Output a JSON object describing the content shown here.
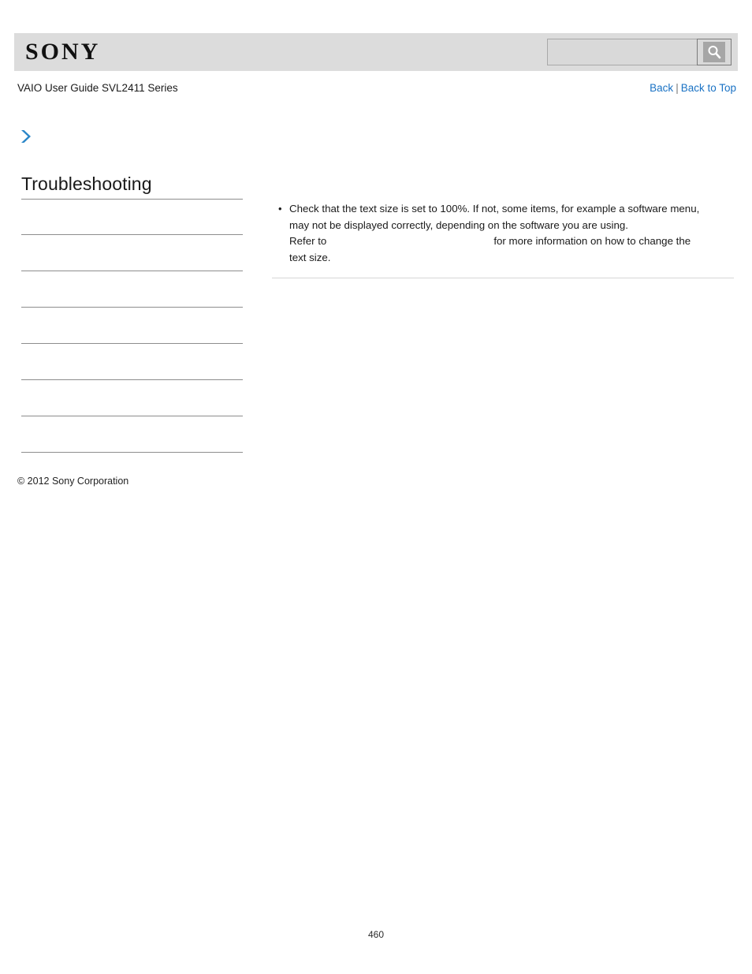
{
  "header": {
    "logo_text": "SONY",
    "search": {
      "value": "",
      "placeholder": "",
      "button_icon": "search-icon"
    }
  },
  "subheader": {
    "guide_title": "VAIO User Guide SVL2411 Series",
    "links": {
      "back": "Back",
      "separator": "|",
      "back_to_top": "Back to Top"
    }
  },
  "sidebar": {
    "arrow_icon": "chevron-right-icon",
    "heading": "Troubleshooting",
    "items": [
      {
        "label": ""
      },
      {
        "label": ""
      },
      {
        "label": ""
      },
      {
        "label": ""
      },
      {
        "label": ""
      },
      {
        "label": ""
      },
      {
        "label": ""
      }
    ]
  },
  "content": {
    "bullets": [
      {
        "lines": [
          "Check that the text size is set to 100%. If not, some items, for example a software menu,",
          "may not be displayed correctly, depending on the software you are using.",
          "Refer to",
          "for more information on how to change the",
          "text size."
        ]
      }
    ]
  },
  "footer": {
    "copyright": "© 2012 Sony Corporation",
    "page_number": "460"
  },
  "colors": {
    "header_band": "#dcdcdc",
    "link_blue": "#1a72c4",
    "arrow_blue": "#2b86c8",
    "rule_gray": "#8d8d8d",
    "content_rule": "#d6d6d6"
  }
}
